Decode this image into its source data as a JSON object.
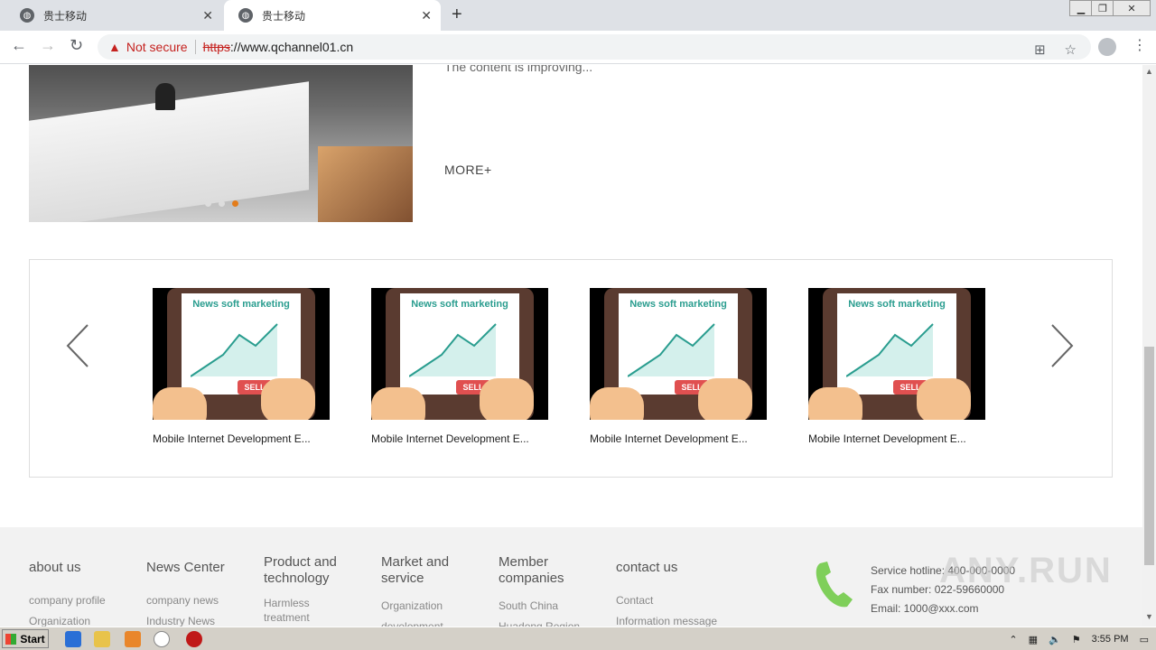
{
  "browser": {
    "tabs": [
      {
        "title": "贵士移动"
      },
      {
        "title": "贵士移动"
      }
    ],
    "address": {
      "security_label": "Not secure",
      "scheme": "https",
      "rest": "://www.qchannel01.cn"
    }
  },
  "page": {
    "intro_text": "The content is improving...",
    "more_label": "MORE+",
    "carousel": {
      "cards": [
        {
          "headline": "News soft marketing",
          "sell": "SELL",
          "caption": "Mobile Internet Development E..."
        },
        {
          "headline": "News soft marketing",
          "sell": "SELL",
          "caption": "Mobile Internet Development E..."
        },
        {
          "headline": "News soft marketing",
          "sell": "SELL",
          "caption": "Mobile Internet Development E..."
        },
        {
          "headline": "News soft marketing",
          "sell": "SELL",
          "caption": "Mobile Internet Development E..."
        }
      ]
    },
    "footer": {
      "columns": [
        {
          "title": "about us",
          "links": [
            "company profile",
            "Organization"
          ]
        },
        {
          "title": "News Center",
          "links": [
            "company news",
            "Industry News"
          ]
        },
        {
          "title": "Product and technology",
          "links": [
            "Harmless treatment"
          ]
        },
        {
          "title": "Market and service",
          "links": [
            "Organization",
            "development"
          ]
        },
        {
          "title": "Member companies",
          "links": [
            "South China",
            "Huadong Region"
          ]
        },
        {
          "title": "contact us",
          "links": [
            "Contact",
            "Information message"
          ]
        }
      ],
      "hotline": "Service hotline: 400-000-0000",
      "fax": "Fax number: 022-59660000",
      "email": "Email: 1000@xxx.com",
      "watermark": "ANY.RUN"
    }
  },
  "taskbar": {
    "start_label": "Start",
    "time": "3:55 PM"
  }
}
